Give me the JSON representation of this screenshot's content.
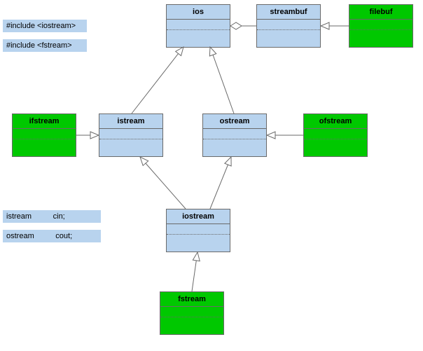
{
  "classes": {
    "ios": {
      "label": "ios"
    },
    "streambuf": {
      "label": "streambuf"
    },
    "filebuf": {
      "label": "filebuf"
    },
    "istream": {
      "label": "istream"
    },
    "ostream": {
      "label": "ostream"
    },
    "ifstream": {
      "label": "ifstream"
    },
    "ofstream": {
      "label": "ofstream"
    },
    "iostream": {
      "label": "iostream"
    },
    "fstream": {
      "label": "fstream"
    }
  },
  "notes": {
    "include_iostream": "#include <iostream>",
    "include_fstream": "#include <fstream>",
    "cin_decl": "istream          cin;",
    "cout_decl": "ostream          cout;"
  }
}
